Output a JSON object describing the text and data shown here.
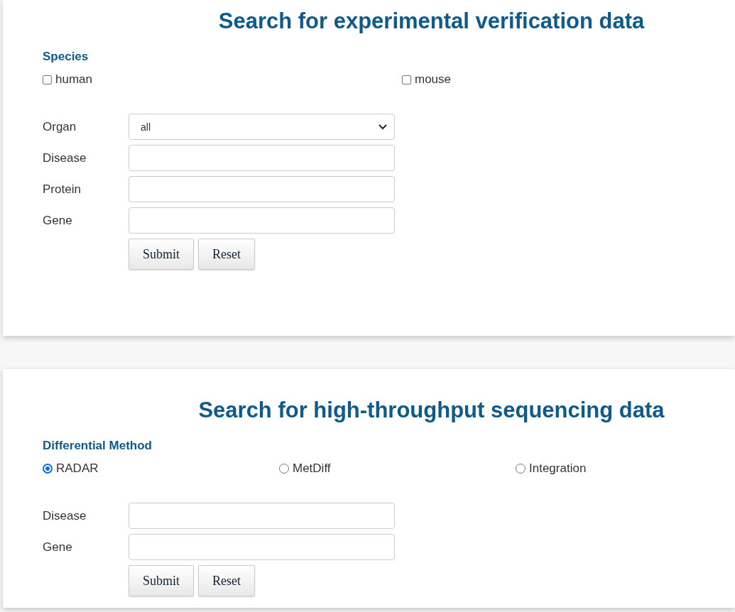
{
  "panels": [
    {
      "title": "Search for experimental verification data",
      "group_label": "Species",
      "options": [
        {
          "kind": "checkbox",
          "label": "human",
          "checked": false
        },
        {
          "kind": "checkbox",
          "label": "mouse",
          "checked": false
        }
      ],
      "fields": [
        {
          "label": "Organ",
          "kind": "select",
          "value": "all"
        },
        {
          "label": "Disease",
          "kind": "text"
        },
        {
          "label": "Protein",
          "kind": "text"
        },
        {
          "label": "Gene",
          "kind": "text"
        }
      ],
      "buttons": [
        "Submit",
        "Reset"
      ]
    },
    {
      "title": "Search for high-throughput sequencing data",
      "group_label": "Differential Method",
      "options": [
        {
          "kind": "radio",
          "label": "RADAR",
          "checked": true
        },
        {
          "kind": "radio",
          "label": "MetDiff",
          "checked": false
        },
        {
          "kind": "radio",
          "label": "Integration",
          "checked": false
        }
      ],
      "fields": [
        {
          "label": "Disease",
          "kind": "text"
        },
        {
          "label": "Gene",
          "kind": "text"
        }
      ],
      "buttons": [
        "Submit",
        "Reset"
      ]
    }
  ]
}
